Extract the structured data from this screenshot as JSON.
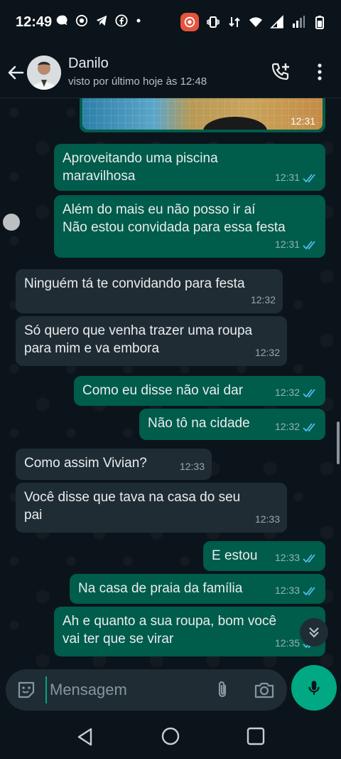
{
  "status_bar": {
    "time": "12:49"
  },
  "header": {
    "contact_name": "Danilo",
    "contact_status": "visto por último hoje às 12:48"
  },
  "image_message": {
    "time": "12:31"
  },
  "messages": [
    {
      "direction": "out",
      "text": "Aproveitando uma piscina\nmaravilhosa",
      "time": "12:31",
      "ticks": "read"
    },
    {
      "direction": "out",
      "text": "Além do mais eu não posso ir aí\nNão estou convidada para essa festa",
      "time": "12:31",
      "ticks": "read"
    },
    {
      "direction": "in",
      "text": "Ninguém tá te convidando para festa",
      "time": "12:32"
    },
    {
      "direction": "in",
      "text": "Só quero que venha trazer uma roupa\npara mim e va embora",
      "time": "12:32"
    },
    {
      "direction": "out",
      "text": "Como eu disse não vai dar",
      "time": "12:32",
      "ticks": "read"
    },
    {
      "direction": "out",
      "text": "Não tô na cidade",
      "time": "12:32",
      "ticks": "read"
    },
    {
      "direction": "in",
      "text": "Como assim Vivian?",
      "time": "12:33"
    },
    {
      "direction": "in",
      "text": "Você disse que tava na casa do seu\npai",
      "time": "12:33"
    },
    {
      "direction": "out",
      "text": "E estou",
      "time": "12:33",
      "ticks": "read"
    },
    {
      "direction": "out",
      "text": "Na casa de praia da família",
      "time": "12:33",
      "ticks": "read"
    },
    {
      "direction": "out",
      "text": "Ah e quanto a sua roupa, bom você\nvai ter que se virar",
      "time": "12:35",
      "ticks": "read"
    }
  ],
  "composer": {
    "placeholder": "Mensagem"
  },
  "colors": {
    "accent": "#00a884",
    "outgoing": "#005c4b",
    "incoming": "#202c33",
    "read_ticks": "#53bdeb"
  }
}
